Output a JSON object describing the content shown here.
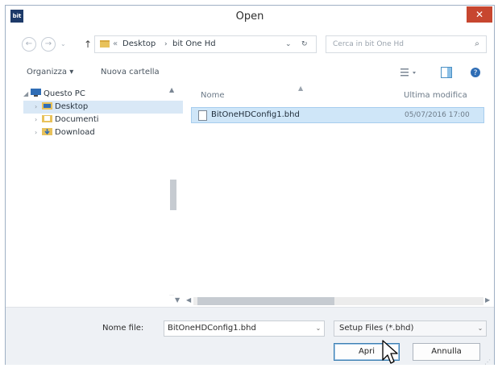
{
  "window": {
    "title": "Open",
    "app_icon_text": "bit"
  },
  "address": {
    "breadcrumbs": [
      "Desktop",
      "bit One Hd"
    ],
    "prefix": "«"
  },
  "search": {
    "placeholder": "Cerca in bit One Hd"
  },
  "toolbar": {
    "organize_label": "Organizza ▾",
    "new_folder_label": "Nuova cartella"
  },
  "tree": {
    "root": "Questo PC",
    "items": [
      "Desktop",
      "Documenti",
      "Download"
    ]
  },
  "columns": {
    "name": "Nome",
    "modified": "Ultima modifica"
  },
  "files": [
    {
      "name": "BitOneHDConfig1.bhd",
      "modified": "05/07/2016 17:00"
    }
  ],
  "bottom": {
    "filename_label": "Nome file:",
    "filename_value": "BitOneHDConfig1.bhd",
    "filter_value": "Setup Files (*.bhd)",
    "open_label": "Apri",
    "cancel_label": "Annulla"
  },
  "colors": {
    "accent": "#3c7fb1",
    "close": "#c7462f",
    "selection": "#cfe6f8",
    "folder": "#e8c25b"
  }
}
